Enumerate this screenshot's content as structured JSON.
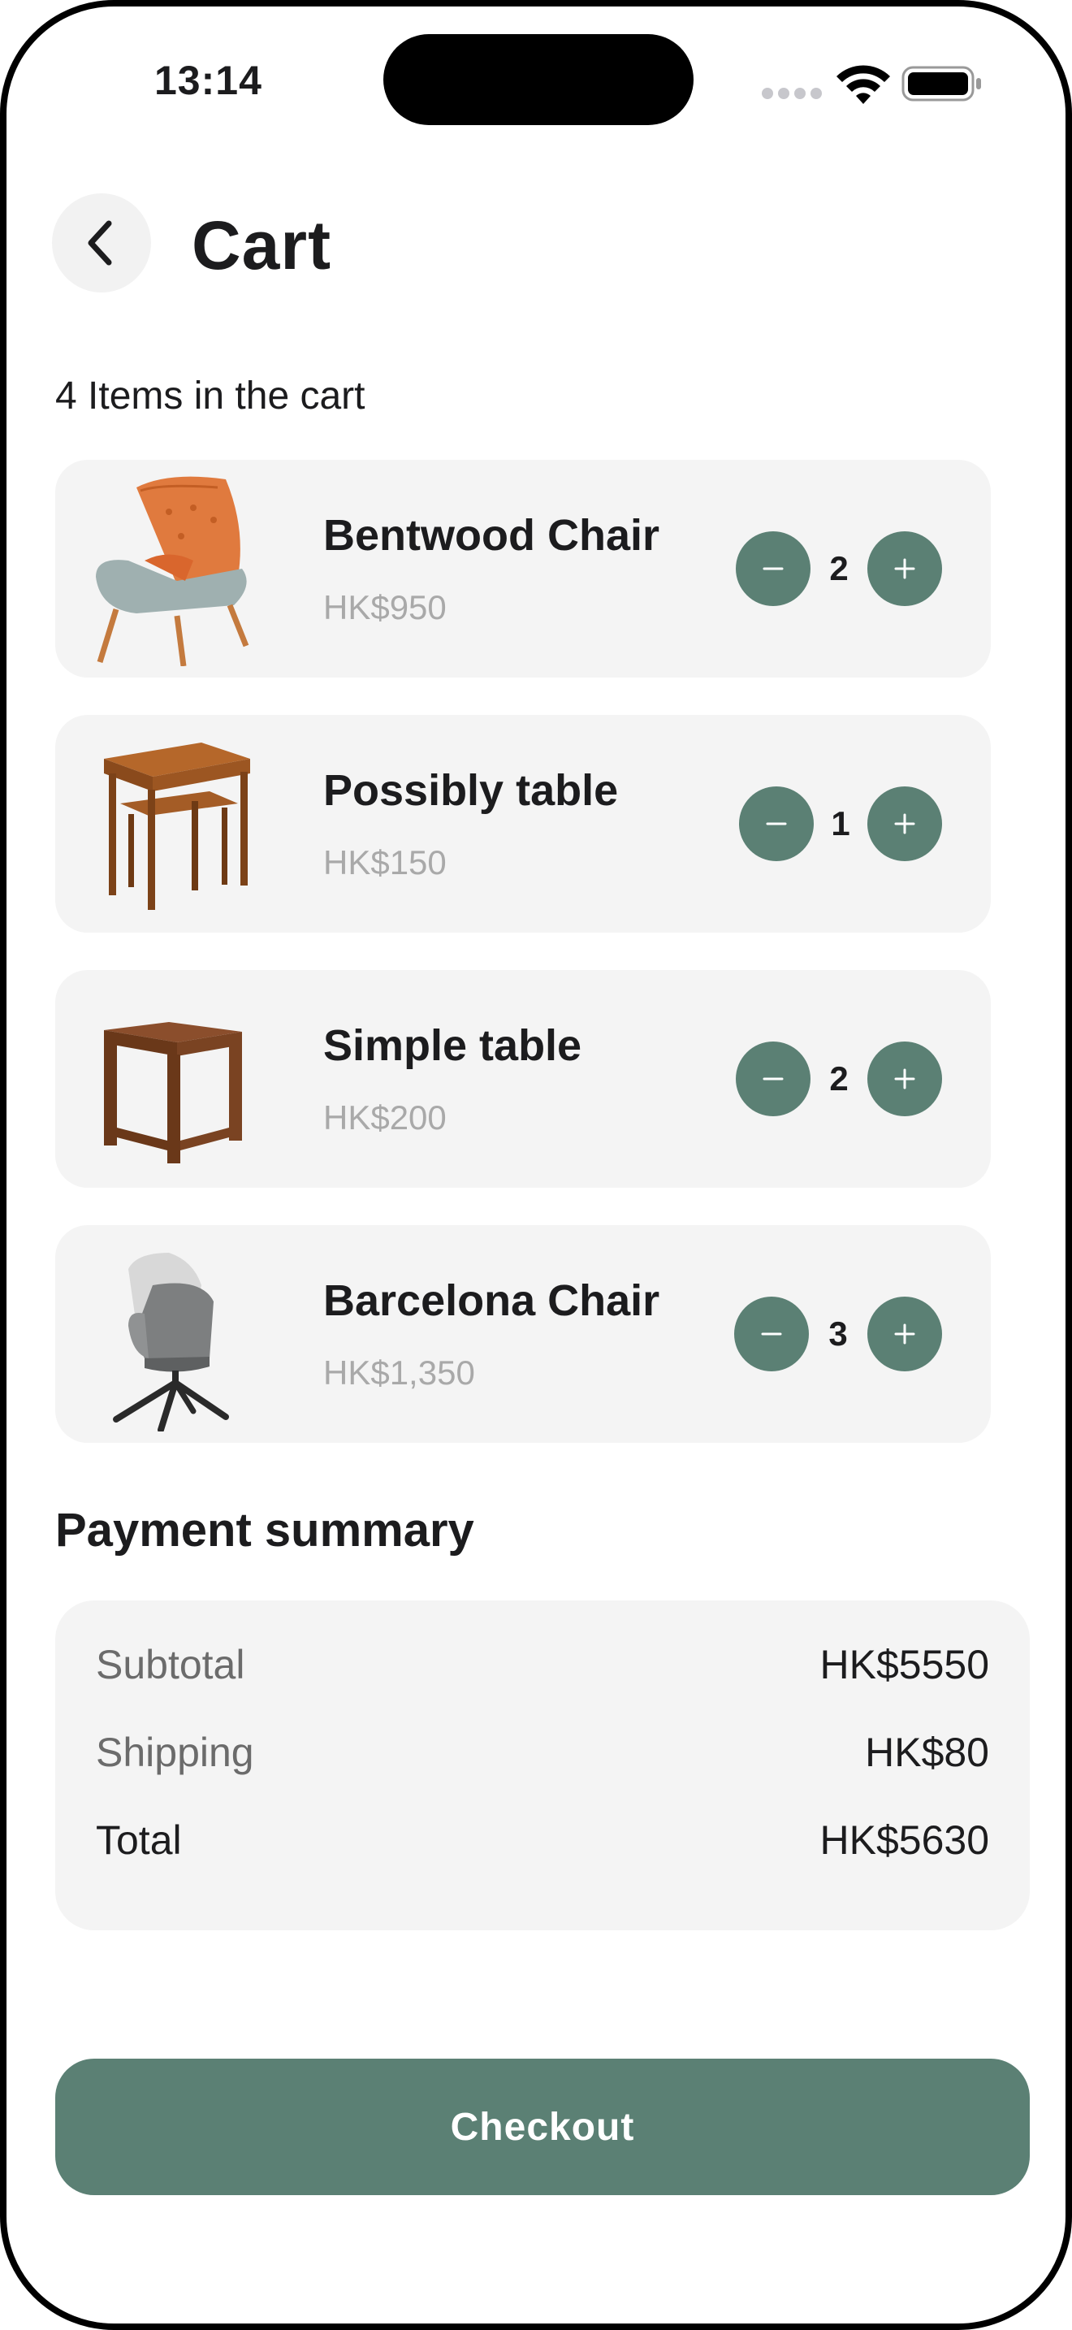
{
  "status_bar": {
    "time": "13:14"
  },
  "header": {
    "title": "Cart"
  },
  "cart": {
    "count_label": "4 Items in the cart",
    "items": [
      {
        "name": "Bentwood Chair",
        "price": "HK$950",
        "quantity": "2",
        "thumb": "armchair-orange"
      },
      {
        "name": "Possibly table",
        "price": "HK$150",
        "quantity": "1",
        "thumb": "nesting-table"
      },
      {
        "name": "Simple table",
        "price": "HK$200",
        "quantity": "2",
        "thumb": "side-table"
      },
      {
        "name": "Barcelona Chair",
        "price": "HK$1,350",
        "quantity": "3",
        "thumb": "swivel-chair-grey"
      }
    ]
  },
  "summary": {
    "title": "Payment summary",
    "rows": [
      {
        "label": "Subtotal",
        "value": "HK$5550"
      },
      {
        "label": "Shipping",
        "value": "HK$80"
      },
      {
        "label": "Total",
        "value": "HK$5630"
      }
    ]
  },
  "checkout": {
    "label": "Checkout"
  },
  "colors": {
    "accent": "#5b8074",
    "card": "#f4f4f4",
    "muted": "#a9a9a9"
  }
}
